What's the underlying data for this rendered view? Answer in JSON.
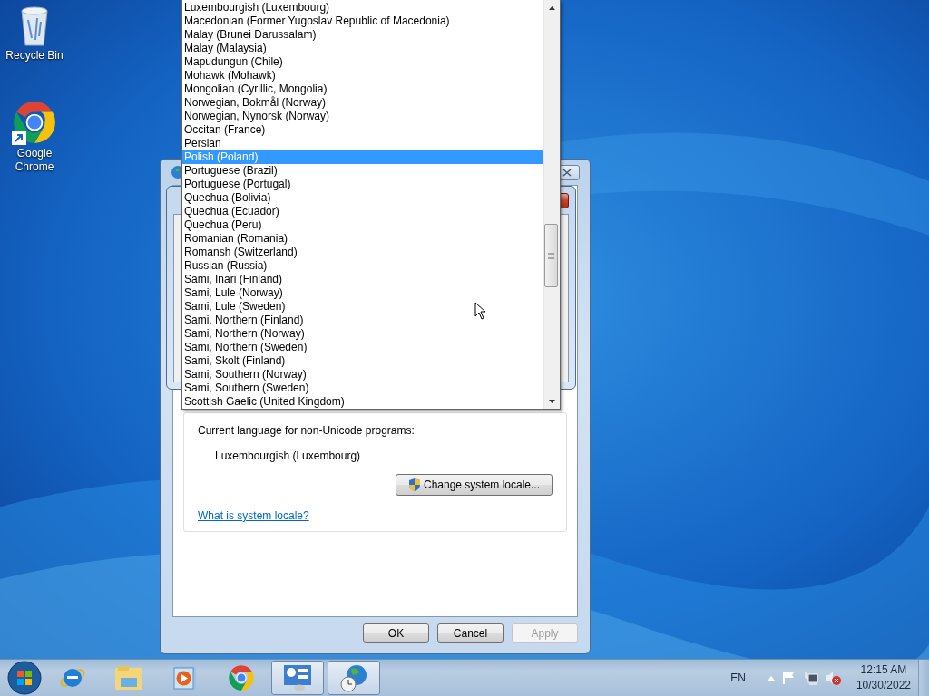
{
  "desktop_icons": [
    {
      "kind": "recycle",
      "label": "Recycle Bin"
    },
    {
      "kind": "chrome",
      "label": "Google Chrome"
    }
  ],
  "dialog": {
    "locale_group": {
      "label": "Current language for non-Unicode programs:",
      "value": "Luxembourgish (Luxembourg)",
      "button": "Change system locale...",
      "link": "What is system locale?"
    },
    "buttons": [
      {
        "label": "OK",
        "disabled": false
      },
      {
        "label": "Cancel",
        "disabled": false
      },
      {
        "label": "Apply",
        "disabled": true
      }
    ]
  },
  "dropdown": {
    "items": [
      {
        "label": "Luxembourgish (Luxembourg)",
        "selected": false
      },
      {
        "label": "Macedonian (Former Yugoslav Republic of Macedonia)",
        "selected": false
      },
      {
        "label": "Malay (Brunei Darussalam)",
        "selected": false
      },
      {
        "label": "Malay (Malaysia)",
        "selected": false
      },
      {
        "label": "Mapudungun (Chile)",
        "selected": false
      },
      {
        "label": "Mohawk (Mohawk)",
        "selected": false
      },
      {
        "label": "Mongolian (Cyrillic, Mongolia)",
        "selected": false
      },
      {
        "label": "Norwegian, Bokmål (Norway)",
        "selected": false
      },
      {
        "label": "Norwegian, Nynorsk (Norway)",
        "selected": false
      },
      {
        "label": "Occitan (France)",
        "selected": false
      },
      {
        "label": "Persian",
        "selected": false
      },
      {
        "label": "Polish (Poland)",
        "selected": true
      },
      {
        "label": "Portuguese (Brazil)",
        "selected": false
      },
      {
        "label": "Portuguese (Portugal)",
        "selected": false
      },
      {
        "label": "Quechua (Bolivia)",
        "selected": false
      },
      {
        "label": "Quechua (Ecuador)",
        "selected": false
      },
      {
        "label": "Quechua (Peru)",
        "selected": false
      },
      {
        "label": "Romanian (Romania)",
        "selected": false
      },
      {
        "label": "Romansh (Switzerland)",
        "selected": false
      },
      {
        "label": "Russian (Russia)",
        "selected": false
      },
      {
        "label": "Sami, Inari (Finland)",
        "selected": false
      },
      {
        "label": "Sami, Lule (Norway)",
        "selected": false
      },
      {
        "label": "Sami, Lule (Sweden)",
        "selected": false
      },
      {
        "label": "Sami, Northern (Finland)",
        "selected": false
      },
      {
        "label": "Sami, Northern (Norway)",
        "selected": false
      },
      {
        "label": "Sami, Northern (Sweden)",
        "selected": false
      },
      {
        "label": "Sami, Skolt (Finland)",
        "selected": false
      },
      {
        "label": "Sami, Southern (Norway)",
        "selected": false
      },
      {
        "label": "Sami, Southern (Sweden)",
        "selected": false
      },
      {
        "label": "Scottish Gaelic (United Kingdom)",
        "selected": false
      }
    ]
  },
  "taskbar": {
    "apps": [
      {
        "kind": "ie",
        "active": false
      },
      {
        "kind": "explorer",
        "active": false
      },
      {
        "kind": "media",
        "active": false
      },
      {
        "kind": "chrome",
        "active": false
      },
      {
        "kind": "control",
        "active": true
      },
      {
        "kind": "region",
        "active": true
      }
    ],
    "tray": {
      "language": "EN",
      "time": "12:15 AM",
      "date": "10/30/2022"
    }
  }
}
